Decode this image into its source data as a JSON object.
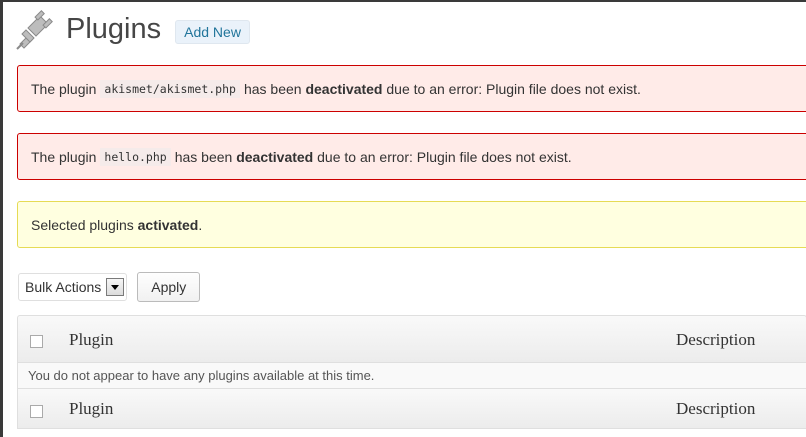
{
  "header": {
    "title": "Plugins",
    "add_new_label": "Add New"
  },
  "notices": [
    {
      "type": "error",
      "prefix": "The plugin",
      "code": "akismet/akismet.php",
      "middle": "has been",
      "bold": "deactivated",
      "suffix": "due to an error: Plugin file does not exist."
    },
    {
      "type": "error",
      "prefix": "The plugin",
      "code": "hello.php",
      "middle": "has been",
      "bold": "deactivated",
      "suffix": "due to an error: Plugin file does not exist."
    },
    {
      "type": "updated",
      "prefix": "Selected plugins",
      "bold": "activated",
      "suffix": "."
    }
  ],
  "bulk_actions": {
    "selected": "Bulk Actions",
    "apply_label": "Apply"
  },
  "table": {
    "columns": [
      "Plugin",
      "Description"
    ],
    "empty_message": "You do not appear to have any plugins available at this time."
  },
  "colors": {
    "error_bg": "#ffebe8",
    "error_border": "#cc0000",
    "updated_bg": "#ffffe0",
    "updated_border": "#e6db55",
    "link": "#21759b"
  }
}
